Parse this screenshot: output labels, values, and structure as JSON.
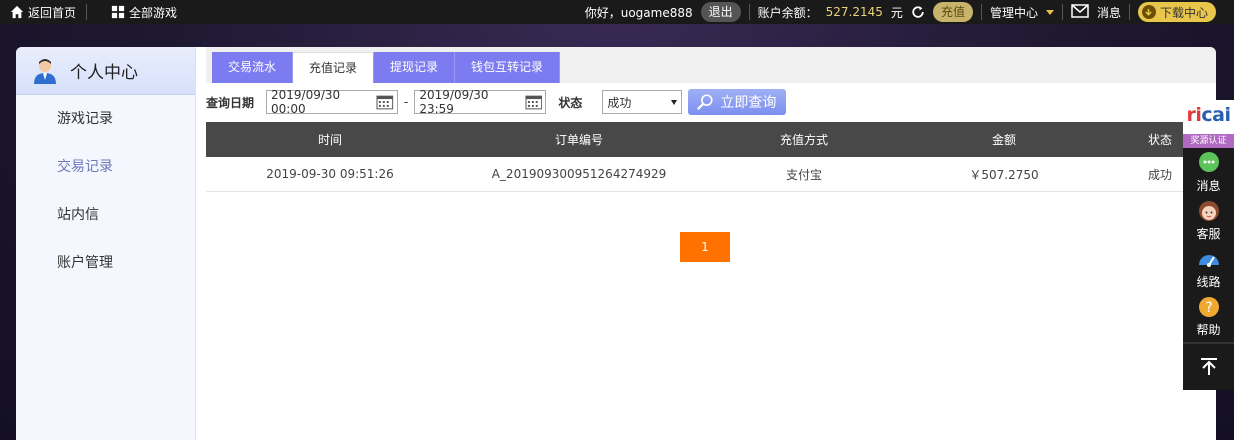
{
  "topbar": {
    "home_label": "返回首页",
    "all_games_label": "全部游戏",
    "greeting": "你好，uogame888",
    "logout_label": "退出",
    "balance_label": "账户余额：",
    "balance_value": "527.2145",
    "balance_unit": "元",
    "recharge_label": "充值",
    "manage_label": "管理中心",
    "message_label": "消息",
    "download_label": "下载中心"
  },
  "sidebar": {
    "title": "个人中心",
    "items": [
      {
        "label": "游戏记录"
      },
      {
        "label": "交易记录"
      },
      {
        "label": "站内信"
      },
      {
        "label": "账户管理"
      }
    ]
  },
  "tabs": [
    {
      "label": "交易流水"
    },
    {
      "label": "充值记录"
    },
    {
      "label": "提现记录"
    },
    {
      "label": "钱包互转记录"
    }
  ],
  "query": {
    "date_label": "查询日期",
    "start_date": "2019/09/30 00:00",
    "separator": "-",
    "end_date": "2019/09/30 23:59",
    "status_label": "状态",
    "status_value": "成功",
    "submit_label": "立即查询"
  },
  "table": {
    "headers": [
      "时间",
      "订单编号",
      "充值方式",
      "金额",
      "状态"
    ],
    "rows": [
      [
        "2019-09-30 09:51:26",
        "A_20190930095126427492​9",
        "支付宝",
        "￥507.2750",
        "成功"
      ]
    ]
  },
  "pagination": {
    "current": "1"
  },
  "right_bar": {
    "brand_prefix": "ri",
    "brand_suffix": "cai",
    "cert_label": "奖源认证",
    "items": [
      {
        "label": "消息"
      },
      {
        "label": "客服"
      },
      {
        "label": "线路"
      },
      {
        "label": "帮助"
      }
    ]
  },
  "colors": {
    "tab_accent": "#7c7cf0",
    "balance": "#e8d27a",
    "pager": "#ff7200",
    "table_header": "#484848"
  }
}
